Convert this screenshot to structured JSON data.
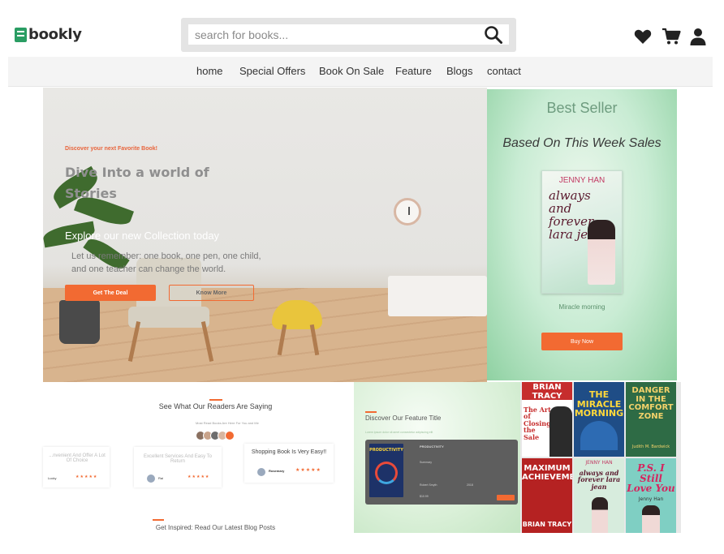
{
  "brand": {
    "name": "bookly"
  },
  "search": {
    "placeholder": "search for books..."
  },
  "header_icons": [
    "heart-icon",
    "cart-icon",
    "user-icon"
  ],
  "nav": {
    "items": [
      {
        "label": "home"
      },
      {
        "label": "Special Offers"
      },
      {
        "label": "Book On Sale"
      },
      {
        "label": "Feature"
      },
      {
        "label": "Blogs"
      },
      {
        "label": "contact"
      }
    ]
  },
  "hero": {
    "eyebrow": "Discover your next Favorite Book!",
    "title": "Dive Into a world of Stories",
    "subtitle": "Explore our new Collection today",
    "paragraph": "Let us remember: one book, one pen, one child, and one teacher can change the world.",
    "primary_button": "Get The Deal",
    "secondary_button": "Know More"
  },
  "best_seller": {
    "title": "Best Seller",
    "subtitle": "Based On This Week Sales",
    "book_author": "JENNY HAN",
    "book_title": "always and forever lara jean",
    "caption": "Miracle morning",
    "button": "Buy Now"
  },
  "reviews": {
    "title": "See What Our Readers Are Saying",
    "tiny_note": "Most Read Books Are Here For You and Me",
    "cards": [
      {
        "text": "...nvenient And Offer A Lot Of Choice",
        "stars": "★★★★★",
        "name": "Lucky"
      },
      {
        "text": "Excellent Services And Easy To Return",
        "stars": "★★★★★",
        "name": "Rai"
      },
      {
        "text": "Shopping Book Is Very Easy!!",
        "stars": "★★★★★",
        "name": "Rosemary"
      }
    ]
  },
  "blog": {
    "title": "Get Inspired: Read Our Latest Blog Posts"
  },
  "feature": {
    "title": "Discover Our Feature Title",
    "tiny_line": "Lorem ipsum dolor sit amet consectetur adipiscing elit",
    "card": {
      "book_title": "PRODUCTIVITY",
      "heading": "PRODUCTIVITY",
      "label": "Summary",
      "author_label": "Robert Smyth",
      "year": "2018",
      "price": "$10.99"
    }
  },
  "book_grid": [
    {
      "author": "BRIAN TRACY",
      "title": "The Art of Closing the Sale"
    },
    {
      "author": "",
      "title": "THE MIRACLE MORNING"
    },
    {
      "author": "Judith M. Bardwick",
      "title": "DANGER IN THE COMFORT ZONE"
    },
    {
      "author": "BRIAN TRACY",
      "title": "MAXIMUM ACHIEVEMENT"
    },
    {
      "author": "JENNY HAN",
      "title": "always and forever lara jean"
    },
    {
      "author": "Jenny Han",
      "title": "P.S. I Still Love You"
    }
  ],
  "colors": {
    "accent": "#f26a32",
    "brand_green": "#2a9d63",
    "nav_bg": "#f4f4f4",
    "text_dark": "#333333"
  }
}
